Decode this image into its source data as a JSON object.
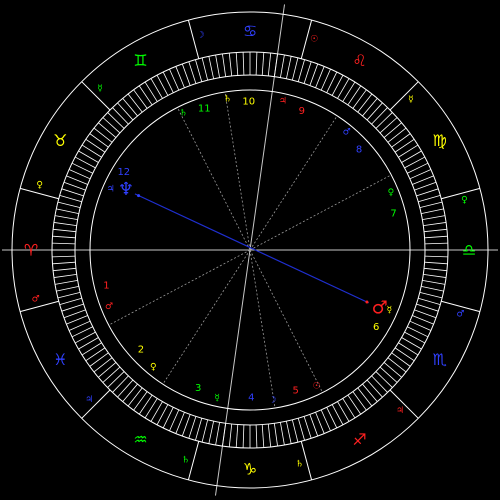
{
  "colors": {
    "background": "#000000",
    "ring": "#ffffff",
    "house_line": "#c8c8c8",
    "dotted_line": "#9a9a9a",
    "aspect_line": "#1f2fd0",
    "fire": "#ff2020",
    "earth": "#ffff00",
    "air": "#00ff00",
    "water": "#3040ff"
  },
  "signs": [
    {
      "id": "aries",
      "glyph": "♈",
      "element": "fire"
    },
    {
      "id": "taurus",
      "glyph": "♉",
      "element": "earth"
    },
    {
      "id": "gemini",
      "glyph": "♊",
      "element": "air"
    },
    {
      "id": "cancer",
      "glyph": "♋",
      "element": "water"
    },
    {
      "id": "leo",
      "glyph": "♌",
      "element": "fire"
    },
    {
      "id": "virgo",
      "glyph": "♍",
      "element": "earth"
    },
    {
      "id": "libra",
      "glyph": "♎",
      "element": "air"
    },
    {
      "id": "scorpio",
      "glyph": "♏",
      "element": "water"
    },
    {
      "id": "sagittarius",
      "glyph": "♐",
      "element": "fire"
    },
    {
      "id": "capricorn",
      "glyph": "♑",
      "element": "earth"
    },
    {
      "id": "aquarius",
      "glyph": "♒",
      "element": "air"
    },
    {
      "id": "pisces",
      "glyph": "♓",
      "element": "water"
    }
  ],
  "ruler_glyphs": [
    "♂",
    "♀",
    "☿",
    "☽",
    "☉",
    "☿",
    "♀",
    "♂",
    "♃",
    "♄",
    "♄",
    "♃"
  ],
  "houses": [
    {
      "num": "1",
      "ruler": "♂",
      "ruler_element": "fire"
    },
    {
      "num": "2",
      "ruler": "♀",
      "ruler_element": "earth"
    },
    {
      "num": "3",
      "ruler": "☿",
      "ruler_element": "air"
    },
    {
      "num": "4",
      "ruler": "☽",
      "ruler_element": "water"
    },
    {
      "num": "5",
      "ruler": "☉",
      "ruler_element": "fire"
    },
    {
      "num": "6",
      "ruler": "☿",
      "ruler_element": "earth"
    },
    {
      "num": "7",
      "ruler": "♀",
      "ruler_element": "air"
    },
    {
      "num": "8",
      "ruler": "♂",
      "ruler_element": "water"
    },
    {
      "num": "9",
      "ruler": "♃",
      "ruler_element": "fire"
    },
    {
      "num": "10",
      "ruler": "♄",
      "ruler_element": "earth"
    },
    {
      "num": "11",
      "ruler": "♄",
      "ruler_element": "air"
    },
    {
      "num": "12",
      "ruler": "♃",
      "ruler_element": "water"
    }
  ],
  "planets": [
    {
      "id": "neptune",
      "glyph": "♆",
      "element": "water"
    },
    {
      "id": "mars",
      "glyph": "♂",
      "element": "fire"
    }
  ]
}
